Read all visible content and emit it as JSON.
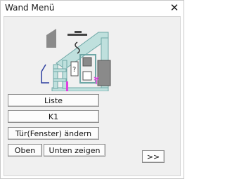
{
  "window": {
    "title": "Wand Menü",
    "close_label": "✕"
  },
  "buttons": {
    "liste": "Liste",
    "k1": "K1",
    "tuer_fenster": "Tür(Fenster) ändern",
    "oben": "Oben",
    "unten_zeigen": "Unten zeigen",
    "more": ">>"
  },
  "picture": {
    "label_question": "?"
  }
}
